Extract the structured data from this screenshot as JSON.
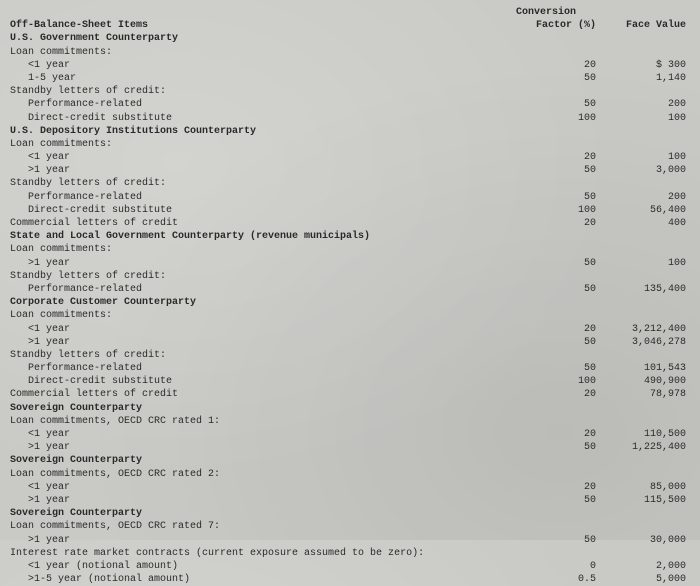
{
  "headers": {
    "items_label": "Off-Balance-Sheet Items",
    "conv_line1": "Conversion",
    "conv_line2": "Factor (%)",
    "face": "Face Value"
  },
  "rows": [
    {
      "label": "U.S. Government Counterparty",
      "bold": true,
      "indent": 0,
      "conv": "",
      "face": ""
    },
    {
      "label": "Loan commitments:",
      "indent": 0,
      "conv": "",
      "face": ""
    },
    {
      "label": "<1 year",
      "indent": 1,
      "conv": "20",
      "face": "$ 300"
    },
    {
      "label": "1-5 year",
      "indent": 1,
      "conv": "50",
      "face": "1,140"
    },
    {
      "label": "Standby letters of credit:",
      "indent": 0,
      "conv": "",
      "face": ""
    },
    {
      "label": "Performance-related",
      "indent": 1,
      "conv": "50",
      "face": "200"
    },
    {
      "label": "Direct-credit substitute",
      "indent": 1,
      "conv": "100",
      "face": "100"
    },
    {
      "label": "U.S. Depository Institutions Counterparty",
      "bold": true,
      "indent": 0,
      "conv": "",
      "face": ""
    },
    {
      "label": "Loan commitments:",
      "indent": 0,
      "conv": "",
      "face": ""
    },
    {
      "label": "<1 year",
      "indent": 1,
      "conv": "20",
      "face": "100"
    },
    {
      "label": ">1 year",
      "indent": 1,
      "conv": "50",
      "face": "3,000"
    },
    {
      "label": "Standby letters of credit:",
      "indent": 0,
      "conv": "",
      "face": ""
    },
    {
      "label": "Performance-related",
      "indent": 1,
      "conv": "50",
      "face": "200"
    },
    {
      "label": "Direct-credit substitute",
      "indent": 1,
      "conv": "100",
      "face": "56,400"
    },
    {
      "label": "Commercial letters of credit",
      "indent": 0,
      "conv": "20",
      "face": "400"
    },
    {
      "label": "State and Local Government Counterparty (revenue municipals)",
      "bold": true,
      "indent": 0,
      "conv": "",
      "face": ""
    },
    {
      "label": "Loan commitments:",
      "indent": 0,
      "conv": "",
      "face": ""
    },
    {
      "label": ">1 year",
      "indent": 1,
      "conv": "50",
      "face": "100"
    },
    {
      "label": "Standby letters of credit:",
      "indent": 0,
      "conv": "",
      "face": ""
    },
    {
      "label": "Performance-related",
      "indent": 1,
      "conv": "50",
      "face": "135,400"
    },
    {
      "label": "Corporate Customer Counterparty",
      "bold": true,
      "indent": 0,
      "conv": "",
      "face": ""
    },
    {
      "label": "Loan commitments:",
      "indent": 0,
      "conv": "",
      "face": ""
    },
    {
      "label": "<1 year",
      "indent": 1,
      "conv": "20",
      "face": "3,212,400"
    },
    {
      "label": ">1 year",
      "indent": 1,
      "conv": "50",
      "face": "3,046,278"
    },
    {
      "label": "Standby letters of credit:",
      "indent": 0,
      "conv": "",
      "face": ""
    },
    {
      "label": "Performance-related",
      "indent": 1,
      "conv": "50",
      "face": "101,543"
    },
    {
      "label": "Direct-credit substitute",
      "indent": 1,
      "conv": "100",
      "face": "490,900"
    },
    {
      "label": "Commercial letters of credit",
      "indent": 0,
      "conv": "20",
      "face": "78,978"
    },
    {
      "label": "Sovereign Counterparty",
      "bold": true,
      "indent": 0,
      "conv": "",
      "face": ""
    },
    {
      "label": "Loan commitments, OECD CRC rated 1:",
      "indent": 0,
      "conv": "",
      "face": ""
    },
    {
      "label": "<1 year",
      "indent": 1,
      "conv": "20",
      "face": "110,500"
    },
    {
      "label": ">1 year",
      "indent": 1,
      "conv": "50",
      "face": "1,225,400"
    },
    {
      "label": "Sovereign Counterparty",
      "bold": true,
      "indent": 0,
      "conv": "",
      "face": ""
    },
    {
      "label": "Loan commitments, OECD CRC rated 2:",
      "indent": 0,
      "conv": "",
      "face": ""
    },
    {
      "label": "<1 year",
      "indent": 1,
      "conv": "20",
      "face": "85,000"
    },
    {
      "label": ">1 year",
      "indent": 1,
      "conv": "50",
      "face": "115,500"
    },
    {
      "label": "Sovereign Counterparty",
      "bold": true,
      "indent": 0,
      "conv": "",
      "face": ""
    },
    {
      "label": "Loan commitments, OECD CRC rated 7:",
      "indent": 0,
      "conv": "",
      "face": ""
    },
    {
      "label": ">1 year",
      "indent": 1,
      "conv": "50",
      "face": "30,000"
    },
    {
      "label": "Interest rate market contracts (current exposure assumed to be zero):",
      "indent": 0,
      "conv": "",
      "face": ""
    },
    {
      "label": "<1 year (notional amount)",
      "indent": 1,
      "conv": "0",
      "face": "2,000"
    },
    {
      "label": ">1-5 year (notional amount)",
      "indent": 1,
      "conv": "0.5",
      "face": "5,000"
    }
  ]
}
